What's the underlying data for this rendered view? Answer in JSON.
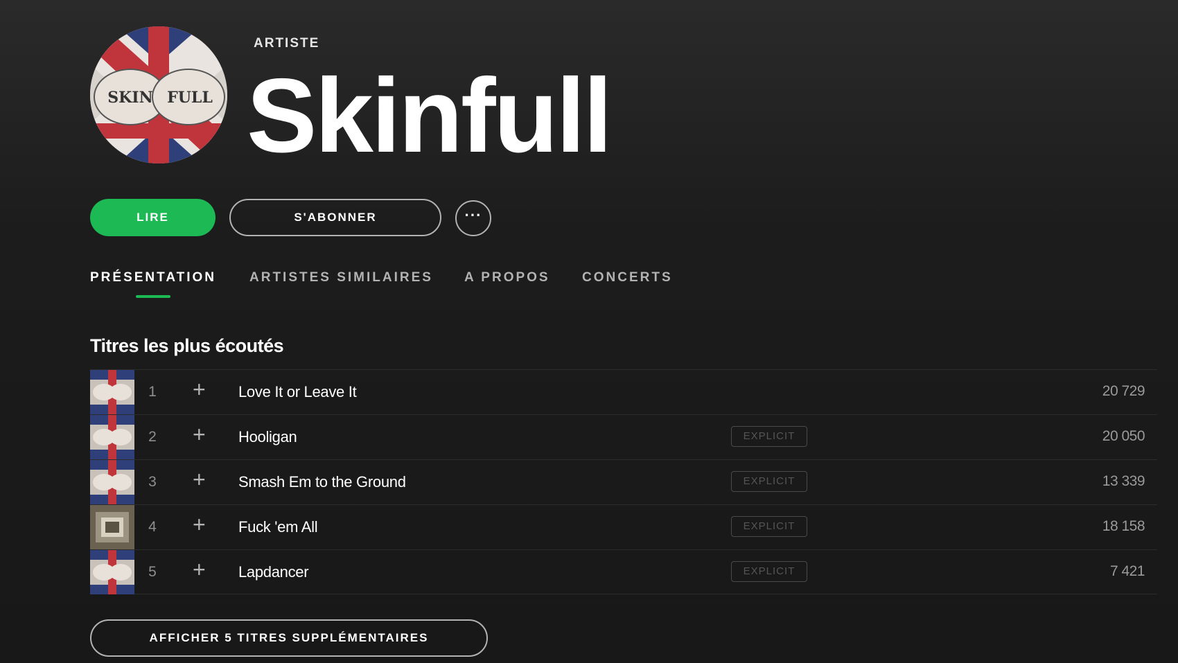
{
  "header": {
    "type_label": "ARTISTE",
    "artist_name": "Skinfull",
    "avatar_text_left": "SKIN",
    "avatar_text_right": "FULL"
  },
  "actions": {
    "play_label": "LIRE",
    "follow_label": "S'ABONNER",
    "more_label": "···"
  },
  "tabs": [
    {
      "label": "PRÉSENTATION",
      "active": true
    },
    {
      "label": "ARTISTES SIMILAIRES",
      "active": false
    },
    {
      "label": "A PROPOS",
      "active": false
    },
    {
      "label": "CONCERTS",
      "active": false
    }
  ],
  "popular": {
    "title": "Titres les plus écoutés",
    "tracks": [
      {
        "num": "1",
        "title": "Love It or Leave It",
        "explicit": "",
        "plays": "20 729"
      },
      {
        "num": "2",
        "title": "Hooligan",
        "explicit": "EXPLICIT",
        "plays": "20 050"
      },
      {
        "num": "3",
        "title": "Smash Em to the Ground",
        "explicit": "EXPLICIT",
        "plays": "13 339"
      },
      {
        "num": "4",
        "title": "Fuck 'em All",
        "explicit": "EXPLICIT",
        "plays": "18 158"
      },
      {
        "num": "5",
        "title": "Lapdancer",
        "explicit": "EXPLICIT",
        "plays": "7 421"
      }
    ],
    "add_icon": "+",
    "show_more_label": "AFFICHER 5 TITRES SUPPLÉMENTAIRES"
  },
  "colors": {
    "accent": "#1db954",
    "background": "#181818",
    "muted_text": "#b3b3b3"
  }
}
